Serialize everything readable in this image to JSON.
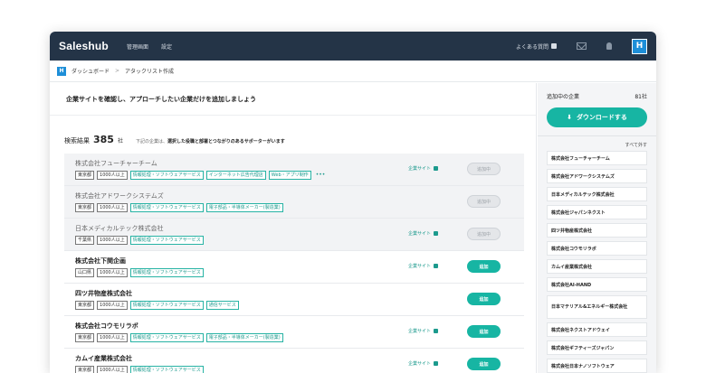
{
  "app": {
    "name": "Saleshub"
  },
  "topnav": {
    "items": [
      "管理画面",
      "設定"
    ],
    "faq": "よくある質問",
    "avatar": "H"
  },
  "breadcrumb": {
    "logo": "H",
    "home": "ダッシュボード",
    "current": "アタックリスト作成"
  },
  "banner": "企業サイトを確認し、アプローチしたい企業だけを追加しましょう",
  "results": {
    "label": "検索結果",
    "count": "385",
    "unit": "社",
    "note_prefix": "下記の企業は、",
    "note_bold": "選択した役職と部署とつながりのあるサポーターがいます"
  },
  "site_label": "企業サイト",
  "add_label": "追加",
  "added_label": "追加中",
  "companies": [
    {
      "name": "株式会社フューチャーチーム",
      "added": true,
      "tags": [
        "東京都",
        "1000人以上"
      ],
      "industries": [
        "情報処理・ソフトウェアサービス",
        "インターネット広告代理店",
        "Web・アプリ制作"
      ],
      "more": "•••"
    },
    {
      "name": "株式会社アドワークシステムズ",
      "added": true,
      "tags": [
        "東京都",
        "1000人以上"
      ],
      "industries": [
        "情報処理・ソフトウェアサービス",
        "電子部品・半導体メーカー(製造業)"
      ]
    },
    {
      "name": "日本メディカルテック株式会社",
      "added": true,
      "tags": [
        "千葉県",
        "1000人以上"
      ],
      "industries": [
        "情報処理・ソフトウェアサービス"
      ]
    },
    {
      "name": "株式会社下関企画",
      "added": false,
      "tags": [
        "山口県",
        "1000人以上"
      ],
      "industries": [
        "情報処理・ソフトウェアサービス"
      ]
    },
    {
      "name": "四ツ井物産株式会社",
      "added": false,
      "tags": [
        "東京都",
        "1000人以上"
      ],
      "industries": [
        "情報処理・ソフトウェアサービス",
        "通信サービス"
      ]
    },
    {
      "name": "株式会社コウモリラボ",
      "added": false,
      "tags": [
        "東京都",
        "1000人以上"
      ],
      "industries": [
        "情報処理・ソフトウェアサービス",
        "電子部品・半導体メーカー(製造業)"
      ]
    },
    {
      "name": "カムイ産業株式会社",
      "added": false,
      "tags": [
        "東京都",
        "1000人以上"
      ],
      "industries": [
        "情報処理・ソフトウェアサービス"
      ]
    }
  ],
  "sidebar": {
    "title": "追加中の企業",
    "count": "81社",
    "download": "ダウンロードする",
    "remove_all": "すべて外す",
    "selected": [
      "株式会社フューチャーチーム",
      "株式会社アドワークシステムズ",
      "日本メディカルテック株式会社",
      "株式会社ジャパンネクスト",
      "四ツ井物産株式会社",
      "株式会社コウモリラボ",
      "カムイ産業株式会社",
      "株式会社AI-HAND",
      "日本マテリアル&エネルギー株式会社",
      "株式会社ネクストアドウェイ",
      "株式会社ギフティーズジャパン",
      "株式会社日本ナノソフトウェア"
    ]
  },
  "colors": {
    "topbar": "#243447",
    "accent": "#17b5a3",
    "brand_blue": "#1e8fd8"
  }
}
